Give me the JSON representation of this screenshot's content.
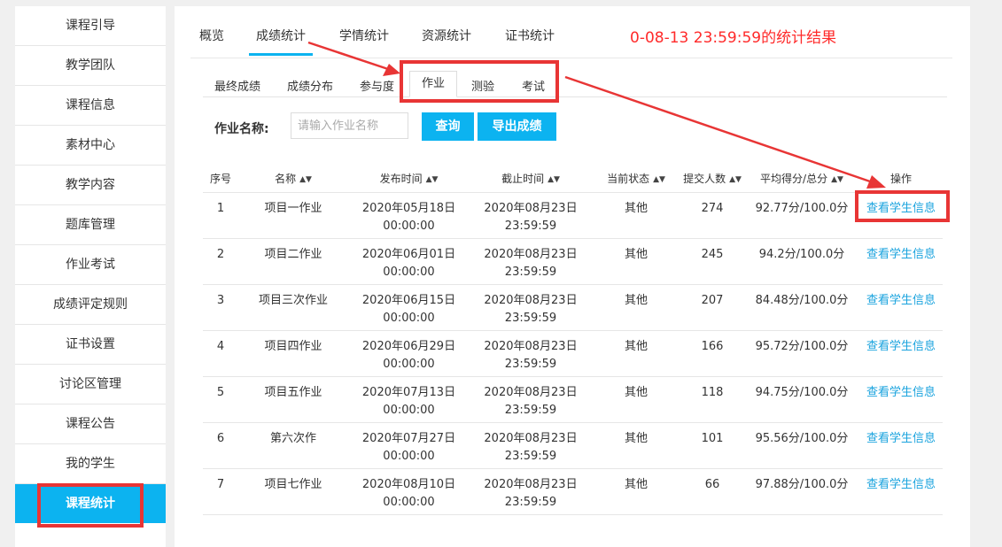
{
  "sidebar": {
    "items": [
      {
        "label": "课程引导"
      },
      {
        "label": "教学团队"
      },
      {
        "label": "课程信息"
      },
      {
        "label": "素材中心"
      },
      {
        "label": "教学内容"
      },
      {
        "label": "题库管理"
      },
      {
        "label": "作业考试"
      },
      {
        "label": "成绩评定规则"
      },
      {
        "label": "证书设置"
      },
      {
        "label": "讨论区管理"
      },
      {
        "label": "课程公告"
      },
      {
        "label": "我的学生"
      },
      {
        "label": "课程统计"
      }
    ],
    "active_index": 12
  },
  "top_tabs": [
    {
      "label": "概览"
    },
    {
      "label": "成绩统计"
    },
    {
      "label": "学情统计"
    },
    {
      "label": "资源统计"
    },
    {
      "label": "证书统计"
    }
  ],
  "stat_note": "0-08-13 23:59:59的统计结果",
  "sub_tabs": [
    {
      "label": "最终成绩"
    },
    {
      "label": "成绩分布"
    },
    {
      "label": "参与度"
    },
    {
      "label": "作业"
    },
    {
      "label": "测验"
    },
    {
      "label": "考试"
    }
  ],
  "search": {
    "label": "作业名称:",
    "placeholder": "请输入作业名称",
    "query_button": "查询",
    "export_button": "导出成绩"
  },
  "table": {
    "headers": [
      "序号",
      "名称",
      "发布时间",
      "截止时间",
      "当前状态",
      "提交人数",
      "平均得分/总分",
      "操作"
    ],
    "rows": [
      {
        "no": "1",
        "name": "项目一作业",
        "pub_date": "2020年05月18日",
        "pub_time": "00:00:00",
        "end_date": "2020年08月23日",
        "end_time": "23:59:59",
        "status": "其他",
        "count": "274",
        "score": "92.77分/100.0分",
        "action": "查看学生信息"
      },
      {
        "no": "2",
        "name": "项目二作业",
        "pub_date": "2020年06月01日",
        "pub_time": "00:00:00",
        "end_date": "2020年08月23日",
        "end_time": "23:59:59",
        "status": "其他",
        "count": "245",
        "score": "94.2分/100.0分",
        "action": "查看学生信息"
      },
      {
        "no": "3",
        "name": "项目三次作业",
        "pub_date": "2020年06月15日",
        "pub_time": "00:00:00",
        "end_date": "2020年08月23日",
        "end_time": "23:59:59",
        "status": "其他",
        "count": "207",
        "score": "84.48分/100.0分",
        "action": "查看学生信息"
      },
      {
        "no": "4",
        "name": "项目四作业",
        "pub_date": "2020年06月29日",
        "pub_time": "00:00:00",
        "end_date": "2020年08月23日",
        "end_time": "23:59:59",
        "status": "其他",
        "count": "166",
        "score": "95.72分/100.0分",
        "action": "查看学生信息"
      },
      {
        "no": "5",
        "name": "项目五作业",
        "pub_date": "2020年07月13日",
        "pub_time": "00:00:00",
        "end_date": "2020年08月23日",
        "end_time": "23:59:59",
        "status": "其他",
        "count": "118",
        "score": "94.75分/100.0分",
        "action": "查看学生信息"
      },
      {
        "no": "6",
        "name": "第六次作",
        "pub_date": "2020年07月27日",
        "pub_time": "00:00:00",
        "end_date": "2020年08月23日",
        "end_time": "23:59:59",
        "status": "其他",
        "count": "101",
        "score": "95.56分/100.0分",
        "action": "查看学生信息"
      },
      {
        "no": "7",
        "name": "项目七作业",
        "pub_date": "2020年08月10日",
        "pub_time": "00:00:00",
        "end_date": "2020年08月23日",
        "end_time": "23:59:59",
        "status": "其他",
        "count": "66",
        "score": "97.88分/100.0分",
        "action": "查看学生信息"
      }
    ]
  },
  "colors": {
    "accent": "#0cb3f0",
    "annotation": "#e83535",
    "link": "#1aa3de"
  }
}
